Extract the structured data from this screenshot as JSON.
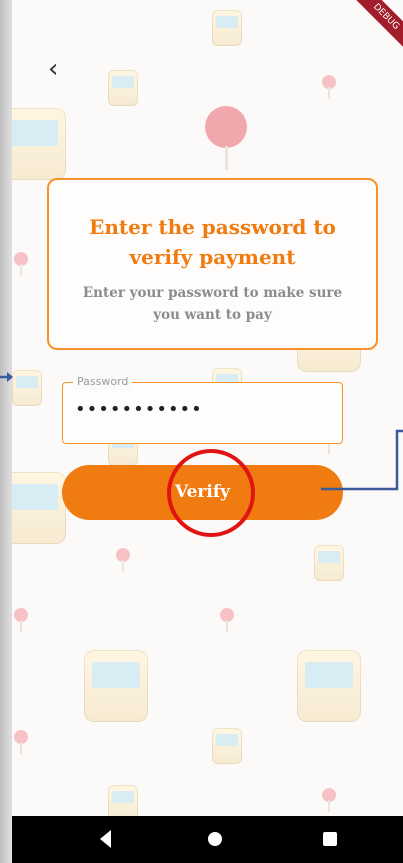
{
  "header": {
    "back_icon": "chevron-left-icon",
    "debug_label": "DEBUG"
  },
  "card": {
    "title": "Enter the password to verify payment",
    "subtitle": "Enter your password to make sure you want to pay"
  },
  "password_field": {
    "label": "Password",
    "value": "•••••••••••"
  },
  "verify_button": {
    "label": "Verify"
  },
  "colors": {
    "accent": "#f07b11",
    "highlight": "#e11414",
    "annotation": "#3a5a9c"
  },
  "navbar": {
    "back": "nav-back-icon",
    "home": "nav-home-icon",
    "recents": "nav-recents-icon"
  }
}
